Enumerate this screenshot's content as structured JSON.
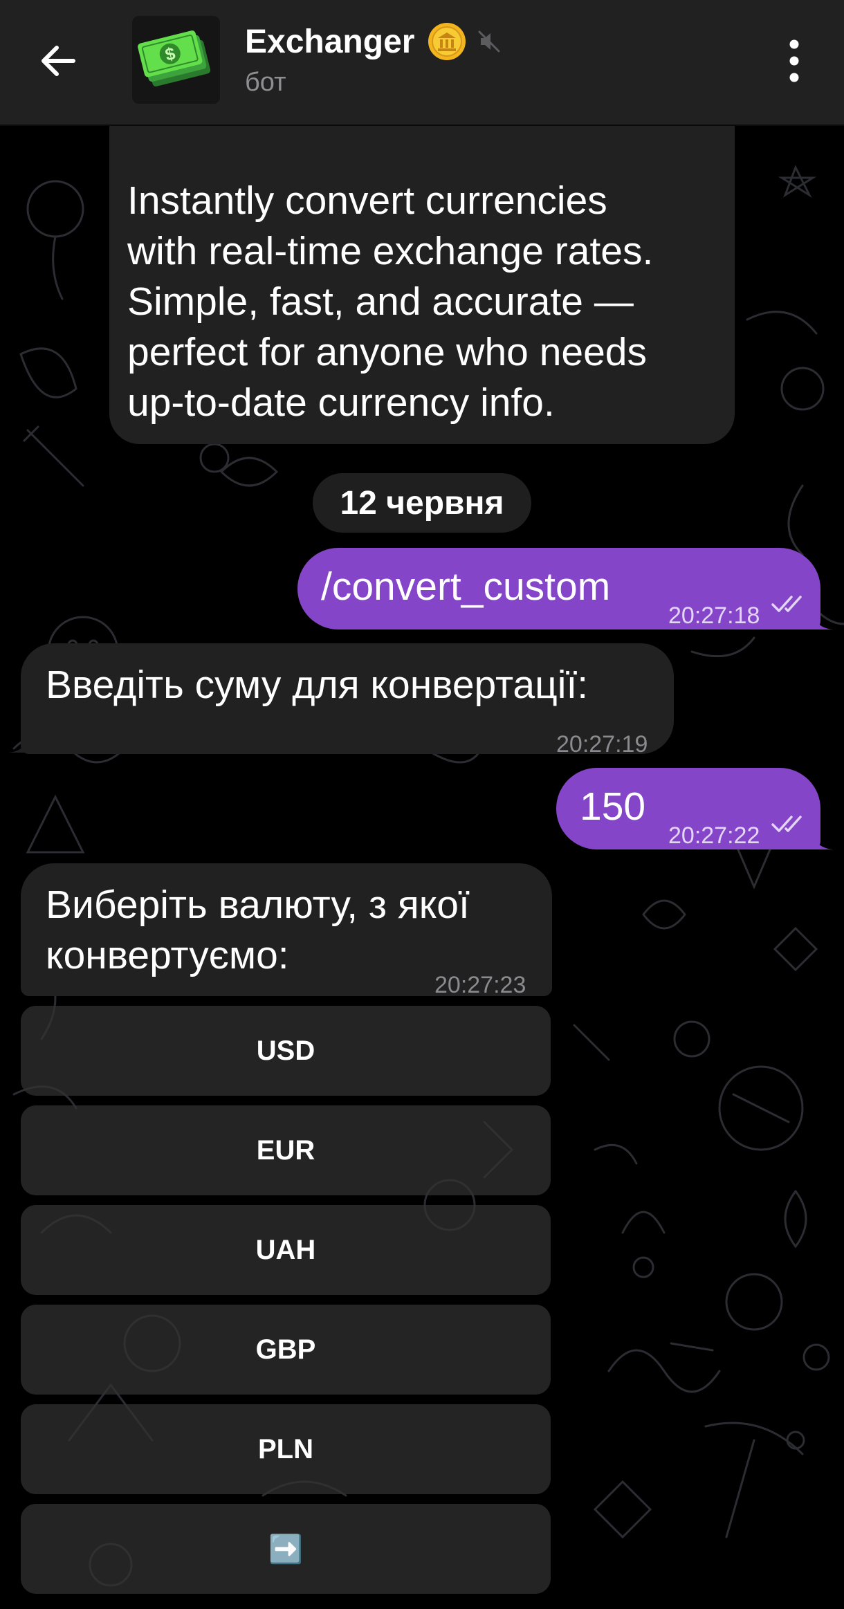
{
  "header": {
    "title": "Exchanger",
    "subtitle": "бот",
    "back_icon": "arrow-left-icon",
    "verified_icon": "gold-coin-badge-icon",
    "muted_icon": "muted-speaker-icon",
    "menu_icon": "more-vert-icon"
  },
  "colors": {
    "header_bg": "#212121",
    "incoming_bubble": "#212121",
    "outgoing_bubble": "#8445c8",
    "keyboard_button": "#323232"
  },
  "messages": [
    {
      "direction": "in",
      "lines": [
        "Instantly convert currencies",
        "with real-time exchange rates.",
        "Simple, fast, and accurate —",
        "perfect for anyone who needs",
        "up-to-date currency info."
      ]
    },
    {
      "direction": "out",
      "text": "/convert_custom",
      "time": "20:27:18",
      "status": "read"
    },
    {
      "direction": "in",
      "text": "Введіть суму для конвертації:",
      "time": "20:27:19"
    },
    {
      "direction": "out",
      "text": "150",
      "time": "20:27:22",
      "status": "read"
    },
    {
      "direction": "in",
      "lines": [
        "Виберіть валюту, з якої",
        "конвертуємо:"
      ],
      "time": "20:27:23"
    }
  ],
  "date_separator": "12 червня",
  "keyboard": {
    "buttons": [
      "USD",
      "EUR",
      "UAH",
      "GBP",
      "PLN",
      "➡️"
    ]
  }
}
